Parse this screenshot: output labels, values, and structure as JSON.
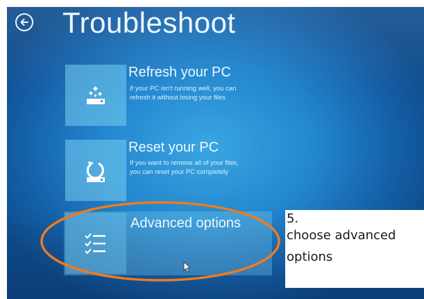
{
  "header": {
    "title": "Troubleshoot",
    "back_icon": "back-arrow-icon"
  },
  "options": {
    "refresh": {
      "title": "Refresh your PC",
      "desc_line1": "If your PC isn't running well, you can",
      "desc_line2": "refresh it without losing your files",
      "icon": "refresh-pc-icon"
    },
    "reset": {
      "title": "Reset your PC",
      "desc_line1": "If you want to remove all of your files,",
      "desc_line2": "you can reset your PC completely",
      "icon": "reset-pc-icon"
    },
    "advanced": {
      "title": "Advanced options",
      "icon": "checklist-icon"
    }
  },
  "annotation": {
    "step": "5.",
    "line1": "choose advanced",
    "line2": "options",
    "highlight_color": "#f07a1e"
  },
  "colors": {
    "background": "#2387cf",
    "tile": "#78cdf0",
    "text": "#eef8ff"
  }
}
